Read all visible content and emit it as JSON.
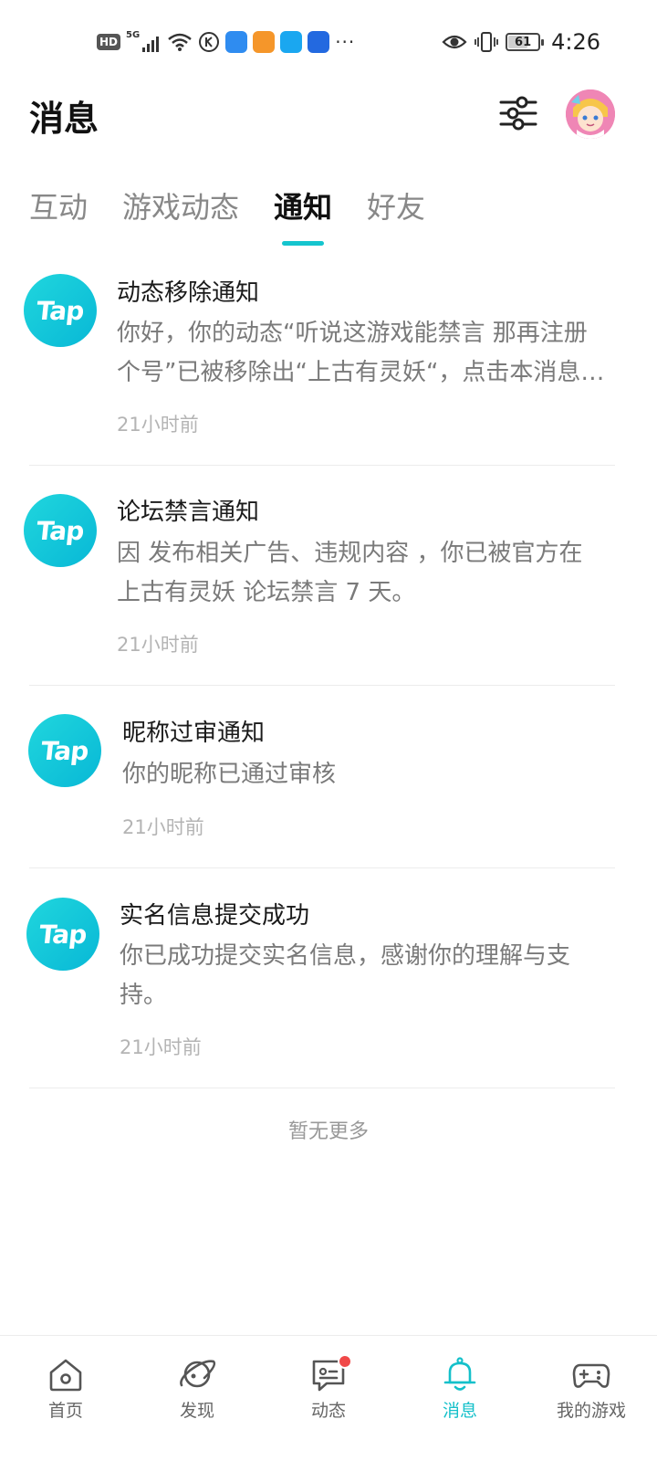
{
  "status_bar": {
    "hd": "HD",
    "network": "5G",
    "more": "···",
    "battery": "61",
    "battery_level": 0.61,
    "time": "4:26",
    "icons": [
      "hd-icon",
      "signal-icon",
      "wifi-icon",
      "k-app-icon",
      "bird-app-icon",
      "play-app-icon",
      "search-app-icon",
      "bulb-app-icon",
      "eye-icon",
      "vibrate-icon",
      "battery-icon"
    ]
  },
  "header": {
    "title": "消息"
  },
  "tabs": [
    {
      "label": "互动",
      "active": false
    },
    {
      "label": "游戏动态",
      "active": false
    },
    {
      "label": "通知",
      "active": true
    },
    {
      "label": "好友",
      "active": false
    }
  ],
  "notifications": [
    {
      "logo": "Tap",
      "title": "动态移除通知",
      "body": "你好，你的动态“听说这游戏能禁言 那再注册个号”已被移除出“上古有灵妖“，点击本消息查看详情",
      "time": "21小时前"
    },
    {
      "logo": "Tap",
      "title": "论坛禁言通知",
      "body": "因 发布相关广告、违规内容 ，你已被官方在 上古有灵妖 论坛禁言 7 天。",
      "time": "21小时前"
    },
    {
      "logo": "Tap",
      "title": "昵称过审通知",
      "body": "你的昵称已通过审核",
      "time": "21小时前"
    },
    {
      "logo": "Tap",
      "title": "实名信息提交成功",
      "body": "你已成功提交实名信息，感谢你的理解与支持。",
      "time": "21小时前"
    }
  ],
  "no_more": "暂无更多",
  "bottom_nav": [
    {
      "label": "首页",
      "icon": "home-icon",
      "active": false
    },
    {
      "label": "发现",
      "icon": "planet-icon",
      "active": false
    },
    {
      "label": "动态",
      "icon": "chat-icon",
      "active": false,
      "badge": true
    },
    {
      "label": "消息",
      "icon": "bell-icon",
      "active": true
    },
    {
      "label": "我的游戏",
      "icon": "gamepad-icon",
      "active": false
    }
  ],
  "colors": {
    "accent": "#15c5ce",
    "badge": "#f04848",
    "muted_text": "#7a7a7a"
  }
}
